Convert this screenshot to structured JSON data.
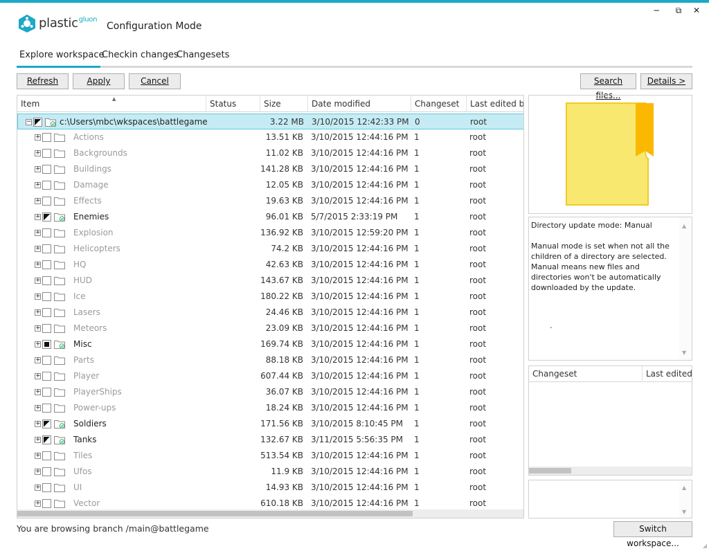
{
  "window": {
    "brand": "plastic",
    "brand_suffix": "gluon",
    "mode_title": "Configuration Mode",
    "controls": {
      "minimize": "−",
      "restore": "⧉",
      "close": "✕"
    },
    "accent_color": "#1ba9c6"
  },
  "tabs": [
    "Explore workspace",
    "Checkin changes",
    "Changesets"
  ],
  "toolbar": {
    "refresh": "Refresh",
    "apply": "Apply",
    "cancel": "Cancel",
    "search_files": "Search files...",
    "details": "Details >"
  },
  "table": {
    "columns": [
      "Item",
      "Status",
      "Size",
      "Date modified",
      "Changeset",
      "Last edited by"
    ],
    "rows": [
      {
        "name": "c:\\Users\\mbc\\wkspaces\\battlegame",
        "size": "3.22 MB",
        "date": "3/10/2015 12:42:33 PM",
        "changeset": "0",
        "editor": "root",
        "check": "partial",
        "folder": "synced",
        "level": 0,
        "expander": "−",
        "selected": true,
        "dark": true
      },
      {
        "name": "Actions",
        "size": "13.51 KB",
        "date": "3/10/2015 12:44:16 PM",
        "changeset": "1",
        "editor": "root",
        "check": "none",
        "folder": "plain",
        "level": 1,
        "expander": "+"
      },
      {
        "name": "Backgrounds",
        "size": "11.02 KB",
        "date": "3/10/2015 12:44:16 PM",
        "changeset": "1",
        "editor": "root",
        "check": "none",
        "folder": "plain",
        "level": 1,
        "expander": "+"
      },
      {
        "name": "Buildings",
        "size": "141.28 KB",
        "date": "3/10/2015 12:44:16 PM",
        "changeset": "1",
        "editor": "root",
        "check": "none",
        "folder": "plain",
        "level": 1,
        "expander": "+"
      },
      {
        "name": "Damage",
        "size": "12.05 KB",
        "date": "3/10/2015 12:44:16 PM",
        "changeset": "1",
        "editor": "root",
        "check": "none",
        "folder": "plain",
        "level": 1,
        "expander": "+"
      },
      {
        "name": "Effects",
        "size": "19.63 KB",
        "date": "3/10/2015 12:44:16 PM",
        "changeset": "1",
        "editor": "root",
        "check": "none",
        "folder": "plain",
        "level": 1,
        "expander": "+"
      },
      {
        "name": "Enemies",
        "size": "96.01 KB",
        "date": "5/7/2015 2:33:19 PM",
        "changeset": "1",
        "editor": "root",
        "check": "partial",
        "folder": "synced",
        "level": 1,
        "expander": "+",
        "dark": true
      },
      {
        "name": "Explosion",
        "size": "136.92 KB",
        "date": "3/10/2015 12:59:20 PM",
        "changeset": "1",
        "editor": "root",
        "check": "none",
        "folder": "plain",
        "level": 1,
        "expander": "+"
      },
      {
        "name": "Helicopters",
        "size": "74.2 KB",
        "date": "3/10/2015 12:44:16 PM",
        "changeset": "1",
        "editor": "root",
        "check": "none",
        "folder": "plain",
        "level": 1,
        "expander": "+"
      },
      {
        "name": "HQ",
        "size": "42.63 KB",
        "date": "3/10/2015 12:44:16 PM",
        "changeset": "1",
        "editor": "root",
        "check": "none",
        "folder": "plain",
        "level": 1,
        "expander": "+"
      },
      {
        "name": "HUD",
        "size": "143.67 KB",
        "date": "3/10/2015 12:44:16 PM",
        "changeset": "1",
        "editor": "root",
        "check": "none",
        "folder": "plain",
        "level": 1,
        "expander": "+"
      },
      {
        "name": "Ice",
        "size": "180.22 KB",
        "date": "3/10/2015 12:44:16 PM",
        "changeset": "1",
        "editor": "root",
        "check": "none",
        "folder": "plain",
        "level": 1,
        "expander": "+"
      },
      {
        "name": "Lasers",
        "size": "24.46 KB",
        "date": "3/10/2015 12:44:16 PM",
        "changeset": "1",
        "editor": "root",
        "check": "none",
        "folder": "plain",
        "level": 1,
        "expander": "+"
      },
      {
        "name": "Meteors",
        "size": "23.09 KB",
        "date": "3/10/2015 12:44:16 PM",
        "changeset": "1",
        "editor": "root",
        "check": "none",
        "folder": "plain",
        "level": 1,
        "expander": "+"
      },
      {
        "name": "Misc",
        "size": "169.74 KB",
        "date": "3/10/2015 12:44:16 PM",
        "changeset": "1",
        "editor": "root",
        "check": "full",
        "folder": "synced",
        "level": 1,
        "expander": "+",
        "dark": true
      },
      {
        "name": "Parts",
        "size": "88.18 KB",
        "date": "3/10/2015 12:44:16 PM",
        "changeset": "1",
        "editor": "root",
        "check": "none",
        "folder": "plain",
        "level": 1,
        "expander": "+"
      },
      {
        "name": "Player",
        "size": "607.44 KB",
        "date": "3/10/2015 12:44:16 PM",
        "changeset": "1",
        "editor": "root",
        "check": "none",
        "folder": "plain",
        "level": 1,
        "expander": "+"
      },
      {
        "name": "PlayerShips",
        "size": "36.07 KB",
        "date": "3/10/2015 12:44:16 PM",
        "changeset": "1",
        "editor": "root",
        "check": "none",
        "folder": "plain",
        "level": 1,
        "expander": "+"
      },
      {
        "name": "Power-ups",
        "size": "18.24 KB",
        "date": "3/10/2015 12:44:16 PM",
        "changeset": "1",
        "editor": "root",
        "check": "none",
        "folder": "plain",
        "level": 1,
        "expander": "+"
      },
      {
        "name": "Soldiers",
        "size": "171.56 KB",
        "date": "3/10/2015 8:10:45 PM",
        "changeset": "1",
        "editor": "root",
        "check": "partial",
        "folder": "synced",
        "level": 1,
        "expander": "+",
        "dark": true
      },
      {
        "name": "Tanks",
        "size": "132.67 KB",
        "date": "3/11/2015 5:56:35 PM",
        "changeset": "1",
        "editor": "root",
        "check": "partial",
        "folder": "synced",
        "level": 1,
        "expander": "+",
        "dark": true
      },
      {
        "name": "Tiles",
        "size": "513.54 KB",
        "date": "3/10/2015 12:44:16 PM",
        "changeset": "1",
        "editor": "root",
        "check": "none",
        "folder": "plain",
        "level": 1,
        "expander": "+"
      },
      {
        "name": "Ufos",
        "size": "11.9 KB",
        "date": "3/10/2015 12:44:16 PM",
        "changeset": "1",
        "editor": "root",
        "check": "none",
        "folder": "plain",
        "level": 1,
        "expander": "+"
      },
      {
        "name": "UI",
        "size": "14.93 KB",
        "date": "3/10/2015 12:44:16 PM",
        "changeset": "1",
        "editor": "root",
        "check": "none",
        "folder": "plain",
        "level": 1,
        "expander": "+"
      },
      {
        "name": "Vector",
        "size": "610.18 KB",
        "date": "3/10/2015 12:44:16 PM",
        "changeset": "1",
        "editor": "root",
        "check": "none",
        "folder": "plain",
        "level": 1,
        "expander": "+"
      }
    ]
  },
  "details": {
    "mode_line": "Directory update mode: Manual",
    "description": "Manual mode is set when not all the children of a directory are selected. Manual means new files and directories won't be automatically downloaded by the update.",
    "stray_mark": ".",
    "changeset_columns": [
      "Changeset",
      "Last edited by"
    ]
  },
  "footer": {
    "status": "You are browsing branch /main@battlegame",
    "switch_workspace": "Switch workspace..."
  }
}
